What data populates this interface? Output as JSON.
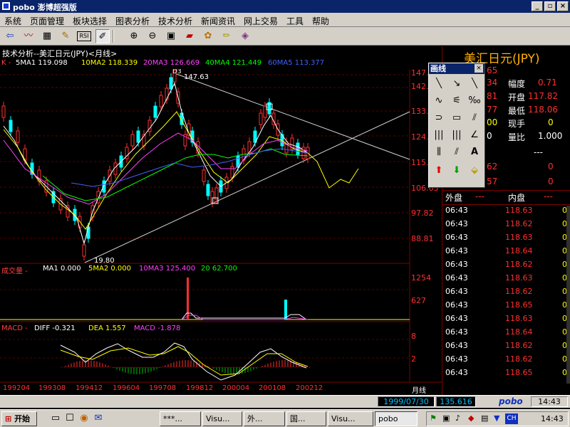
{
  "window": {
    "title": "pobo 澎博超强版"
  },
  "menu": [
    "系统",
    "页面管理",
    "板块选择",
    "图表分析",
    "技术分析",
    "新闻资讯",
    "网上交易",
    "工具",
    "帮助"
  ],
  "chart": {
    "header": "技术分析--美汇日元(JPY)<月线>",
    "ma_label": "K - ",
    "ma": [
      {
        "label": "5MA1 119.098",
        "color": "#ffffff"
      },
      {
        "label": "10MA2 118.339",
        "color": "#ffff00"
      },
      {
        "label": "20MA3 126.669",
        "color": "#ff40ff"
      },
      {
        "label": "40MA4 121.449",
        "color": "#00ff00"
      },
      {
        "label": "60MA5 113.377",
        "color": "#4060ff"
      }
    ],
    "high_label": "147.63",
    "low_label": "19.80",
    "axis_ticks": [
      "147.",
      "142.",
      "133.",
      "124.",
      "115.",
      "106.63",
      "97.82",
      "88.81"
    ],
    "volume": {
      "label": "成交量 - ",
      "items": [
        {
          "label": "MA1 0.000",
          "color": "#ffffff"
        },
        {
          "label": "5MA2 0.000",
          "color": "#ffff00"
        },
        {
          "label": "10MA3 125.400",
          "color": "#ff40ff"
        },
        {
          "label": "20 62.700",
          "color": "#00ff00"
        }
      ],
      "ticks": [
        "1254",
        "627"
      ]
    },
    "macd": {
      "label": "MACD - ",
      "items": [
        {
          "label": "DIFF -0.321",
          "color": "#ffffff"
        },
        {
          "label": "DEA 1.557",
          "color": "#ffff00"
        },
        {
          "label": "MACD -1.878",
          "color": "#ff40ff"
        }
      ],
      "ticks": [
        "8",
        "2"
      ]
    },
    "xaxis": [
      "199204",
      "199308",
      "199412",
      "199604",
      "199708",
      "199812",
      "200004",
      "200108",
      "200212"
    ],
    "period": "月线"
  },
  "right_panel": {
    "title": "美汇日元(JPY)",
    "stats": [
      {
        "k": "幅度",
        "v": "0.71",
        "partial": "34"
      },
      {
        "k": "开盘",
        "v": "117.82",
        "partial": "81"
      },
      {
        "k": "最低",
        "v": "118.06",
        "partial": "77"
      },
      {
        "k": "现手",
        "v": "0",
        "partial": "00"
      },
      {
        "k": "量比",
        "v": "1.000",
        "partial": "0"
      }
    ],
    "top_partial": "65",
    "dash": "---",
    "extra": [
      {
        "partial": "62",
        "v": "0"
      },
      {
        "partial": "57",
        "v": "0"
      }
    ],
    "outer_label": "外盘",
    "outer_value": "---",
    "inner_label": "内盘",
    "inner_value": "---",
    "ticks": [
      {
        "t": "06:43",
        "p": "118.63",
        "q": "0"
      },
      {
        "t": "06:43",
        "p": "118.62",
        "q": "0"
      },
      {
        "t": "06:43",
        "p": "118.63",
        "q": "0"
      },
      {
        "t": "06:43",
        "p": "118.64",
        "q": "0"
      },
      {
        "t": "06:43",
        "p": "118.62",
        "q": "0"
      },
      {
        "t": "06:43",
        "p": "118.63",
        "q": "0"
      },
      {
        "t": "06:43",
        "p": "118.62",
        "q": "0"
      },
      {
        "t": "06:43",
        "p": "118.65",
        "q": "0"
      },
      {
        "t": "06:43",
        "p": "118.63",
        "q": "0"
      },
      {
        "t": "06:43",
        "p": "118.64",
        "q": "0"
      },
      {
        "t": "06:43",
        "p": "118.62",
        "q": "0"
      },
      {
        "t": "06:43",
        "p": "118.62",
        "q": "0"
      },
      {
        "t": "06:43",
        "p": "118.65",
        "q": "0"
      }
    ]
  },
  "draw_palette": {
    "title": "画线",
    "text_tool": "A"
  },
  "status": {
    "date": "1999/07/30",
    "price": "135.616",
    "brand": "pobo",
    "time": "14:43"
  },
  "taskbar": {
    "start": "开始",
    "tasks": [
      "***...",
      "Visu...",
      "外...",
      "国...",
      "Visu...",
      "pobo"
    ],
    "clock": "14:43",
    "tray_ch": "CH"
  }
}
